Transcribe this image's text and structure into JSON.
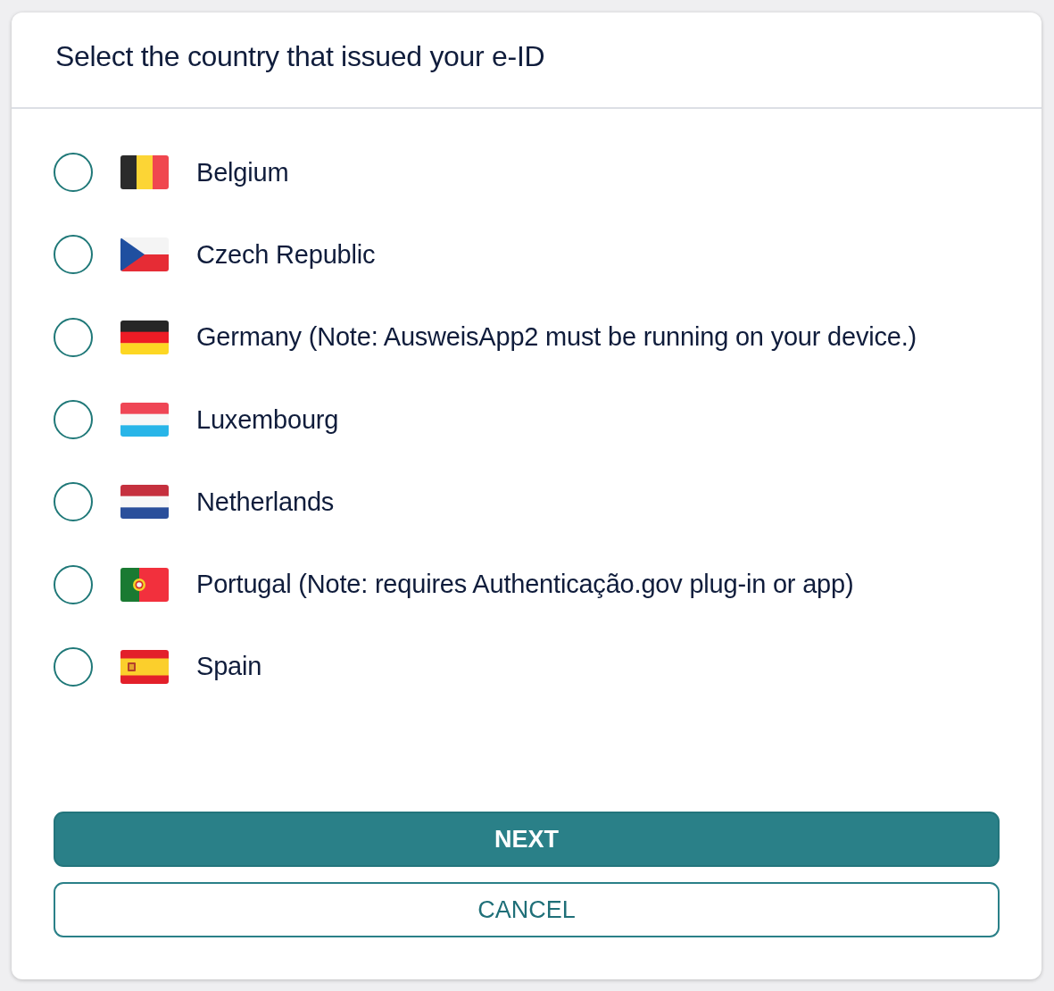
{
  "dialog": {
    "title": "Select the country that issued your e-ID"
  },
  "countries": [
    {
      "kind": "be",
      "label": "Belgium",
      "selected": false
    },
    {
      "kind": "cz",
      "label": "Czech Republic",
      "selected": false
    },
    {
      "kind": "de",
      "label": "Germany (Note: AusweisApp2 must be running on your device.)",
      "selected": false
    },
    {
      "kind": "lu",
      "label": "Luxembourg",
      "selected": false
    },
    {
      "kind": "nl",
      "label": "Netherlands",
      "selected": false
    },
    {
      "kind": "pt",
      "label": "Portugal (Note: requires Authenticação.gov plug-in or app)",
      "selected": false
    },
    {
      "kind": "es",
      "label": "Spain",
      "selected": false
    }
  ],
  "buttons": {
    "primary": "NEXT",
    "secondary": "CANCEL"
  }
}
